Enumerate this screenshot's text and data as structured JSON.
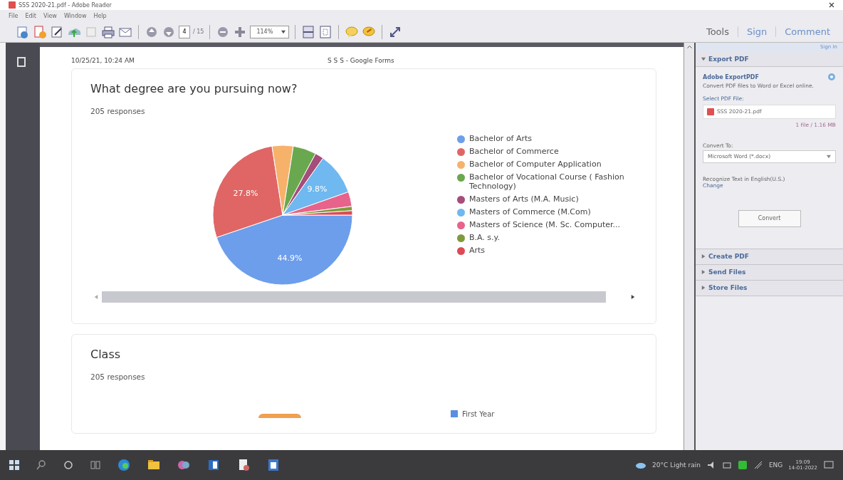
{
  "window": {
    "title": "SSS 2020-21.pdf - Adobe Reader",
    "menu": [
      "File",
      "Edit",
      "View",
      "Window",
      "Help"
    ]
  },
  "toolbar": {
    "page": "4",
    "page_total": "/ 15",
    "zoom": "114%"
  },
  "pane_tabs": [
    {
      "label": "Tools"
    },
    {
      "label": "Sign"
    },
    {
      "label": "Comment"
    }
  ],
  "sign_in": "Sign In",
  "document": {
    "header_time": "10/25/21, 10:24 AM",
    "header_title": "S S S - Google Forms",
    "cards": [
      {
        "question": "What degree are you pursuing now?",
        "responses": "205 responses",
        "chart_data": {
          "type": "pie",
          "categories": [
            "Bachelor of Arts",
            "Bachelor of Commerce",
            "Bachelor of Computer Application",
            "Bachelor of Vocational Course ( Fashion Technology)",
            "Masters of Arts (M.A. Music)",
            "Masters of Commerce (M.Com)",
            "Masters of Science (M. Sc. Computer...",
            "B.A. s.y.",
            "Arts"
          ],
          "values": [
            44.9,
            27.8,
            4.9,
            5.4,
            2.0,
            9.8,
            3.4,
            1.0,
            1.0
          ],
          "colors": [
            "#6d9eeb",
            "#e06666",
            "#f6b26b",
            "#6aa84f",
            "#a64d79",
            "#6fb8f0",
            "#e8638c",
            "#7f9a3c",
            "#dc4b55"
          ],
          "value_labels": [
            "44.9%",
            "27.8%",
            null,
            null,
            null,
            "9.8%",
            null,
            null,
            null
          ]
        }
      },
      {
        "question": "Class",
        "responses": "205 responses",
        "legend": [
          "First Year"
        ]
      }
    ]
  },
  "panel": {
    "export": {
      "heading": "Export PDF",
      "expanded": true,
      "service": "Adobe ExportPDF",
      "description": "Convert PDF files to Word or Excel online.",
      "select_label": "Select PDF File:",
      "file_name": "SSS 2020-21.pdf",
      "file_info": "1 file / 1.16 MB",
      "convert_label": "Convert To:",
      "convert_value": "Microsoft Word (*.docx)",
      "recognize": "Recognize Text in English(U.S.)",
      "change": "Change",
      "button": "Convert"
    },
    "sections": [
      {
        "heading": "Create PDF",
        "expanded": false
      },
      {
        "heading": "Send Files",
        "expanded": false
      },
      {
        "heading": "Store Files",
        "expanded": false
      }
    ]
  },
  "taskbar": {
    "weather": "20°C  Light rain",
    "language": "ENG",
    "time": "19:09",
    "date": "14-01-2022"
  }
}
